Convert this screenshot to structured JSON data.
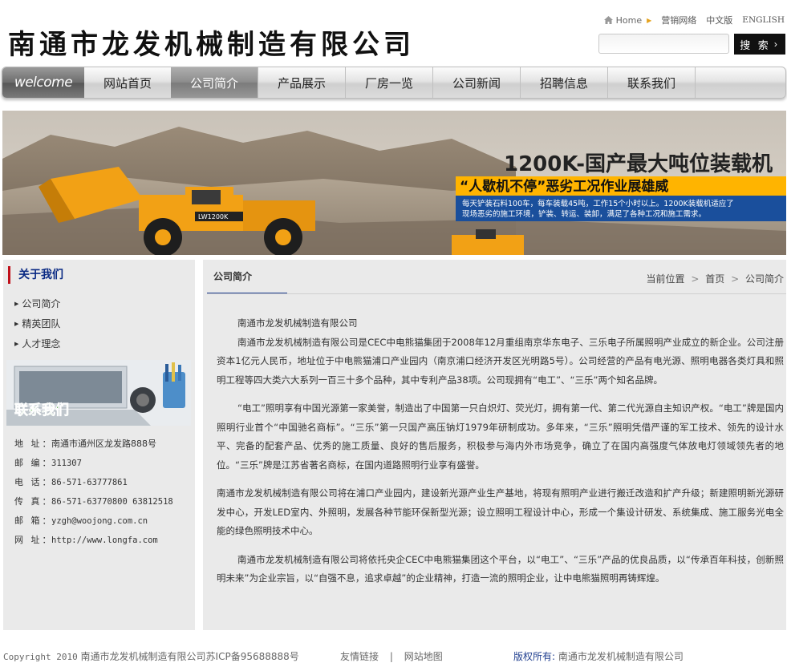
{
  "header": {
    "logo_text": "南通市龙发机械制造有限公司",
    "top_links": {
      "home": "Home",
      "marketing": "营销网络",
      "chinese": "中文版",
      "english": "ENGLISH"
    },
    "search": {
      "placeholder": "",
      "button_label": "搜 索"
    }
  },
  "nav": {
    "welcome": "welcome",
    "items": [
      "网站首页",
      "公司简介",
      "产品展示",
      "厂房一览",
      "公司新闻",
      "招聘信息",
      "联系我们"
    ],
    "active_index": 1
  },
  "banner": {
    "title": "1200K-国产最大吨位装载机",
    "slogan": "“人歇机不停”恶劣工况作业展雄威",
    "desc_line1": "每天铲装石料100车，每车装载45吨，工作15个小时以上。1200K装载机适应了",
    "desc_line2": "现场恶劣的施工环境，铲装、转运、装卸，满足了各种工况和施工需求。",
    "machine_label": "LW1200K",
    "colors": {
      "machine": "#f2a115",
      "slogan_bg": "#ffb400",
      "desc_bg": "#1a4f9c"
    }
  },
  "sidebar": {
    "title": "关于我们",
    "links": [
      "公司简介",
      "精英团队",
      "人才理念"
    ],
    "contact_banner": "联系我们",
    "contact": [
      {
        "label": "地 址：",
        "value": "南通市通州区龙发路888号"
      },
      {
        "label": "邮 编：",
        "value": "311307"
      },
      {
        "label": "电 话：",
        "value": "86-571-63777861"
      },
      {
        "label": "传 真：",
        "value": "86-571-63770800 63812518"
      },
      {
        "label": "邮 箱：",
        "value": "yzgh@woojong.com.cn"
      },
      {
        "label": "网 址：",
        "value": "http://www.longfa.com"
      }
    ]
  },
  "main": {
    "tab": "公司简介",
    "breadcrumb": [
      "当前位置",
      "首页",
      "公司简介"
    ],
    "paragraphs": [
      "南通市龙发机械制造有限公司",
      "南通市龙发机械制造有限公司是CEC中电熊猫集团于2008年12月重组南京华东电子、三乐电子所属照明产业成立的新企业。公司注册资本1亿元人民币，地址位于中电熊猫浦口产业园内（南京浦口经济开发区光明路5号）。公司经营的产品有电光源、照明电器各类灯具和照明工程等四大类六大系列一百三十多个品种，其中专利产品38项。公司现拥有“电工”、“三乐”两个知名品牌。",
      "“电工”照明享有中国光源第一家美誉，制造出了中国第一只白炽灯、荧光灯，拥有第一代、第二代光源自主知识产权。“电工”牌是国内照明行业首个“中国驰名商标”。“三乐”第一只国产高压钠灯1979年研制成功。多年来，“三乐”照明凭借严谨的军工技术、领先的设计水平、完备的配套产品、优秀的施工质量、良好的售后服务，积极参与海内外市场竞争，确立了在国内高强度气体放电灯领域领先者的地位。“三乐”牌是江苏省著名商标，在国内道路照明行业享有盛誉。",
      "南通市龙发机械制造有限公司将在浦口产业园内，建设新光源产业生产基地，将现有照明产业进行搬迁改造和扩产升级；新建照明新光源研发中心，开发LED室内、外照明，发展各种节能环保新型光源；设立照明工程设计中心，形成一个集设计研发、系统集成、施工服务光电全能的绿色照明技术中心。",
      "南通市龙发机械制造有限公司将依托央企CEC中电熊猫集团这个平台，以“电工”、“三乐”产品的优良品质，以“传承百年科技，创新照明未来”为企业宗旨，以“自强不息，追求卓越”的企业精神，打造一流的照明企业，让中电熊猫照明再铸辉煌。"
    ]
  },
  "footer": {
    "copyright_en": "Copyright 2010",
    "copyright_cn": "南通市龙发机械制造有限公司苏ICP备95688888号",
    "link_friends": "友情链接",
    "link_divider": "|",
    "link_sitemap": "网站地图",
    "owner_label": "版权所有:",
    "owner_value": "南通市龙发机械制造有限公司"
  }
}
